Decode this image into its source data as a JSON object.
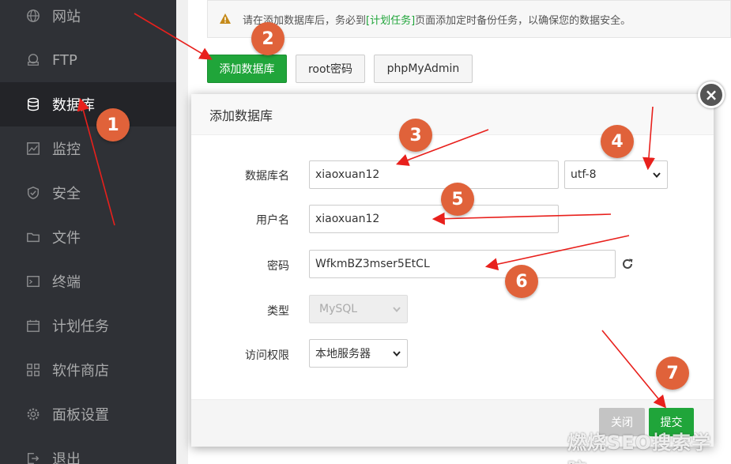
{
  "sidebar": {
    "items": [
      {
        "label": "网站",
        "icon": "globe-icon"
      },
      {
        "label": "FTP",
        "icon": "ftp-icon"
      },
      {
        "label": "数据库",
        "icon": "database-icon",
        "active": true
      },
      {
        "label": "监控",
        "icon": "monitor-icon"
      },
      {
        "label": "安全",
        "icon": "shield-icon"
      },
      {
        "label": "文件",
        "icon": "folder-icon"
      },
      {
        "label": "终端",
        "icon": "terminal-icon"
      },
      {
        "label": "计划任务",
        "icon": "calendar-icon"
      },
      {
        "label": "软件商店",
        "icon": "grid-icon"
      },
      {
        "label": "面板设置",
        "icon": "gear-icon"
      },
      {
        "label": "退出",
        "icon": "logout-icon"
      }
    ]
  },
  "notice": {
    "before": "请在添加数据库后，务必到",
    "link": "[计划任务]",
    "after": "页面添加定时备份任务，以确保您的数据安全。"
  },
  "toolbar": {
    "add_db": "添加数据库",
    "root_pwd": "root密码",
    "phpmyadmin": "phpMyAdmin"
  },
  "modal": {
    "title": "添加数据库",
    "fields": {
      "db_name_label": "数据库名",
      "db_name_value": "xiaoxuan12",
      "charset_value": "utf-8",
      "user_label": "用户名",
      "user_value": "xiaoxuan12",
      "pwd_label": "密码",
      "pwd_value": "WfkmBZ3mser5EtCL",
      "type_label": "类型",
      "type_value": "MySQL",
      "access_label": "访问权限",
      "access_value": "本地服务器"
    },
    "close_label": "关闭",
    "submit_label": "提交"
  },
  "badges": [
    "1",
    "2",
    "3",
    "4",
    "5",
    "6",
    "7"
  ],
  "watermark": "燃烧SEO搜索学院",
  "colors": {
    "sidebar_bg": "#2f3136",
    "sidebar_active_bg": "#232428",
    "accent_green": "#20a53a",
    "badge_orange": "#e0623a",
    "arrow_red": "#e8201c"
  }
}
